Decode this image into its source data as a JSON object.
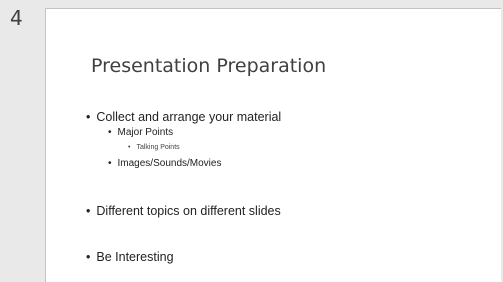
{
  "slide": {
    "number": "4",
    "title": "Presentation Preparation",
    "bullets": [
      {
        "level": 1,
        "text": "Collect and arrange your material"
      },
      {
        "level": 2,
        "text": "Major Points"
      },
      {
        "level": 3,
        "text": "Talking Points"
      },
      {
        "level": 2,
        "text": "Images/Sounds/Movies"
      },
      {
        "level": 1,
        "text": "Different topics on different slides"
      },
      {
        "level": 1,
        "text": "Be Interesting"
      }
    ]
  }
}
